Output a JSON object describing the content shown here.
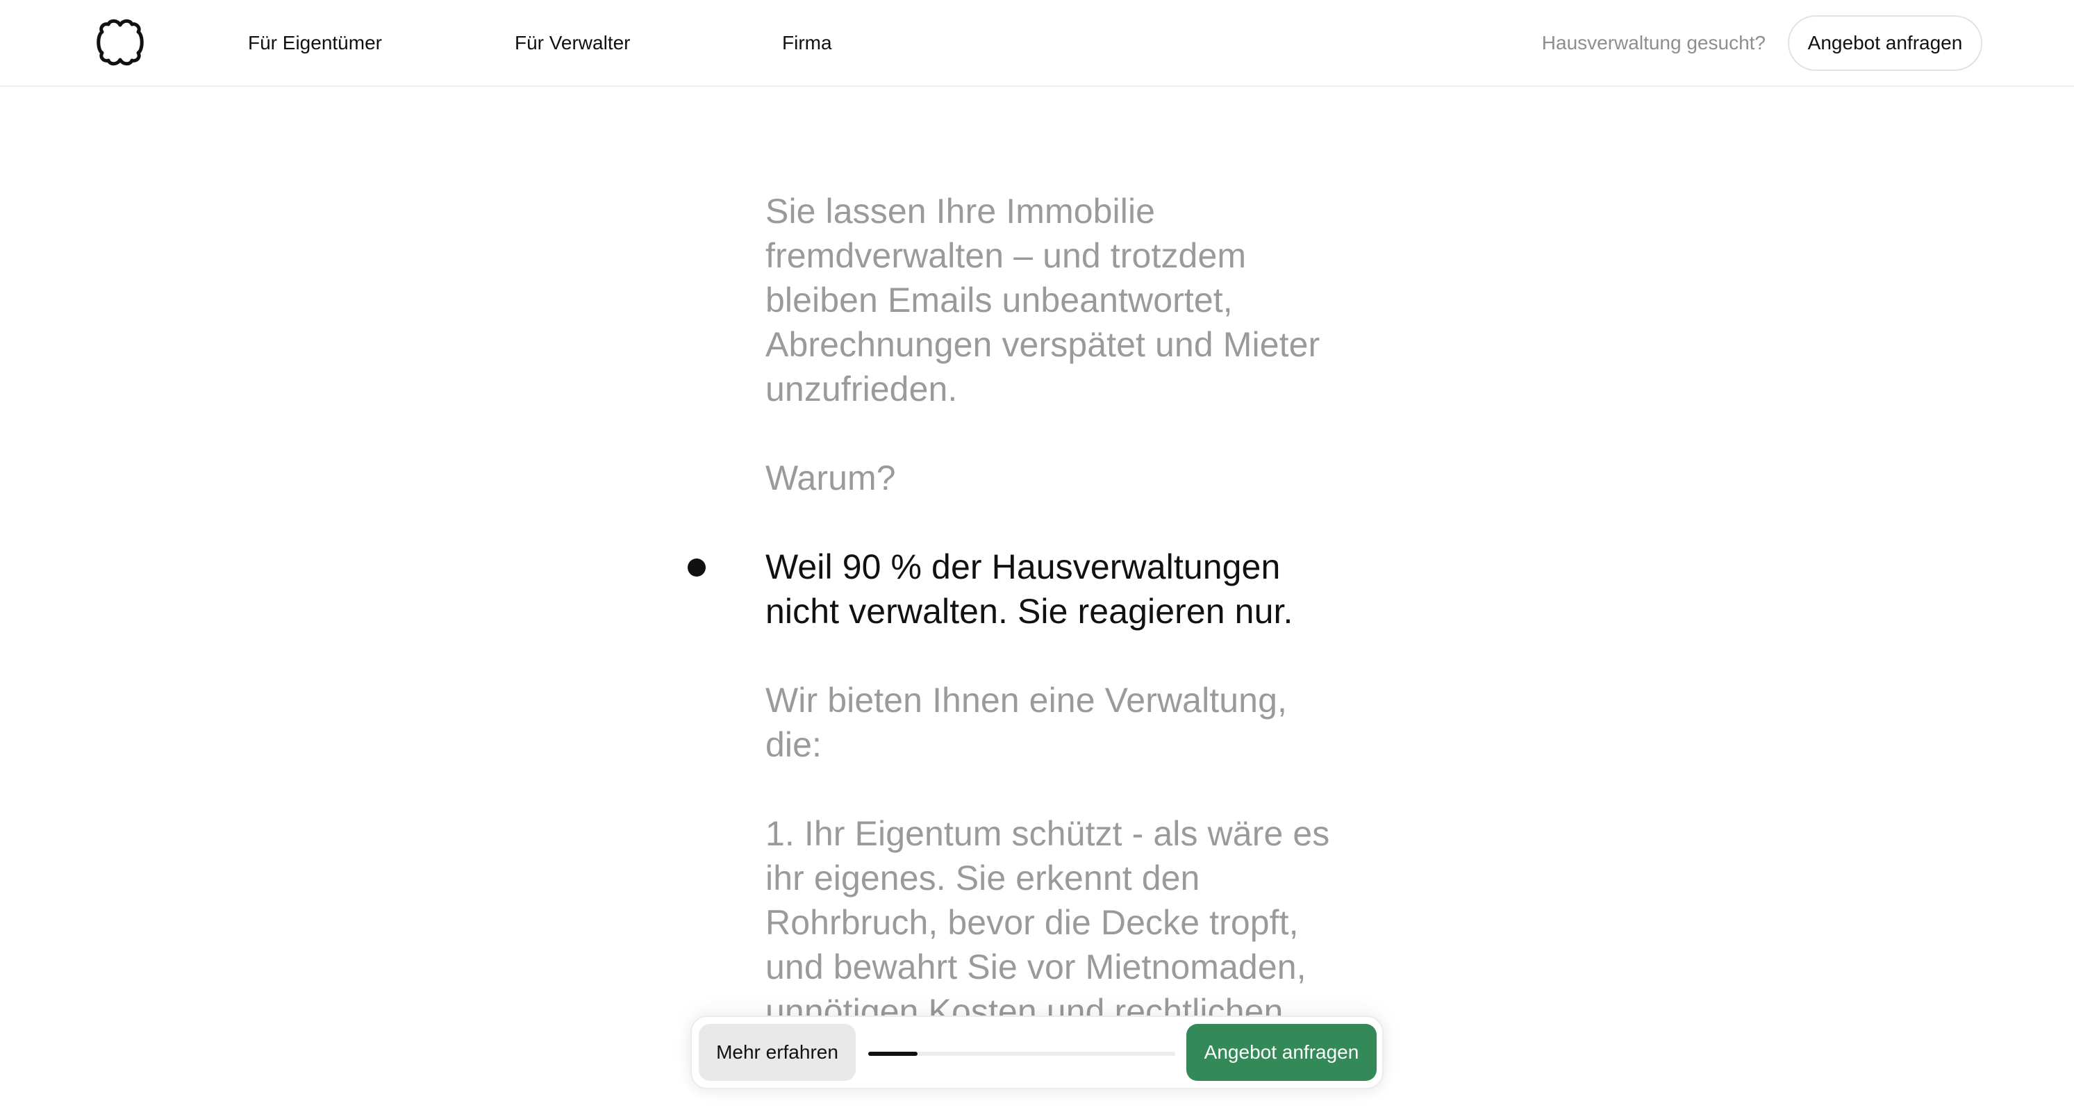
{
  "header": {
    "logo_icon": "clover-outline-icon",
    "nav": {
      "owners": "Für Eigentümer",
      "managers": "Für Verwalter",
      "company": "Firma"
    },
    "search_link": "Hausverwaltung gesucht?",
    "cta_label": "Angebot anfragen"
  },
  "article": {
    "paragraphs": [
      "Sie lassen Ihre Immobilie fremdverwalten – und trotzdem bleiben Emails unbeantwortet, Abrechnungen verspätet und Mieter unzufrieden.",
      "Warum?",
      "Weil 90 % der Hausverwaltungen nicht verwalten. Sie reagieren nur.",
      "Wir bieten Ihnen eine Verwaltung, die:",
      "1. Ihr Eigentum schützt - als wäre es ihr eigenes. Sie erkennt den Rohrbruch, bevor die Decke tropft, und bewahrt Sie vor Mietnomaden, unnötigen Kosten und rechtlichen"
    ],
    "active_index": 2
  },
  "bottom_bar": {
    "more_label": "Mehr erfahren",
    "offer_label": "Angebot anfragen",
    "progress": 0.16
  },
  "colors": {
    "accent_green": "#338a58",
    "muted_text": "#9a9a9a",
    "active_text": "#111111"
  }
}
